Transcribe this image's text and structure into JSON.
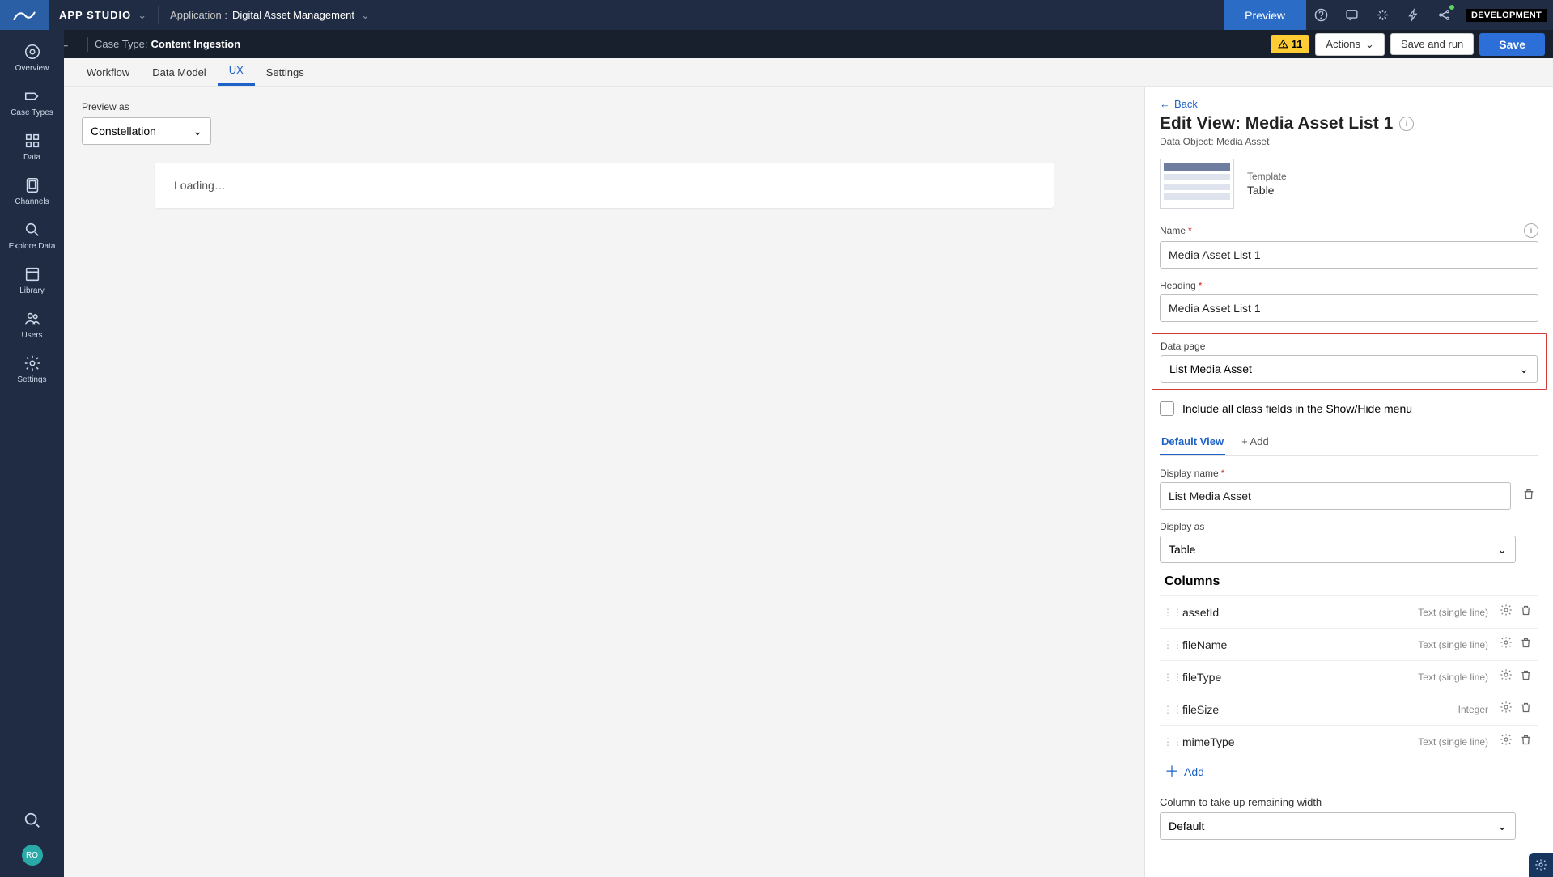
{
  "topbar": {
    "app_studio": "APP STUDIO",
    "application_label": "Application :",
    "application_name": "Digital Asset Management",
    "preview_btn": "Preview",
    "dev_badge": "DEVELOPMENT"
  },
  "subbar": {
    "case_type_label": "Case Type:",
    "case_type_value": "Content Ingestion",
    "warn_count": "11",
    "actions_label": "Actions",
    "save_and_run": "Save and run",
    "save": "Save"
  },
  "tabs": {
    "workflow": "Workflow",
    "data_model": "Data Model",
    "ux": "UX",
    "settings": "Settings"
  },
  "leftnav": {
    "overview": "Overview",
    "case_types": "Case Types",
    "data": "Data",
    "channels": "Channels",
    "explore_data": "Explore Data",
    "library": "Library",
    "users": "Users",
    "settings": "Settings",
    "avatar_initials": "RO"
  },
  "main": {
    "preview_as_label": "Preview as",
    "preview_as_value": "Constellation",
    "loading": "Loading…"
  },
  "rpanel": {
    "back": "Back",
    "title": "Edit View: Media Asset List 1",
    "subtitle": "Data Object: Media Asset",
    "template_label": "Template",
    "template_value": "Table",
    "name_label": "Name",
    "name_value": "Media Asset List 1",
    "heading_label": "Heading",
    "heading_value": "Media Asset List 1",
    "datapage_label": "Data page",
    "datapage_value": "List Media Asset",
    "include_all_label": "Include all class fields in the Show/Hide menu",
    "default_view_tab": "Default View",
    "add_tab": "+ Add",
    "display_name_label": "Display name",
    "display_name_value": "List Media Asset",
    "display_as_label": "Display as",
    "display_as_value": "Table",
    "columns_header": "Columns",
    "columns": [
      {
        "name": "assetId",
        "type": "Text (single line)"
      },
      {
        "name": "fileName",
        "type": "Text (single line)"
      },
      {
        "name": "fileType",
        "type": "Text (single line)"
      },
      {
        "name": "fileSize",
        "type": "Integer"
      },
      {
        "name": "mimeType",
        "type": "Text (single line)"
      }
    ],
    "add_column": "Add",
    "col_remain_label": "Column to take up remaining width",
    "col_remain_value": "Default"
  }
}
